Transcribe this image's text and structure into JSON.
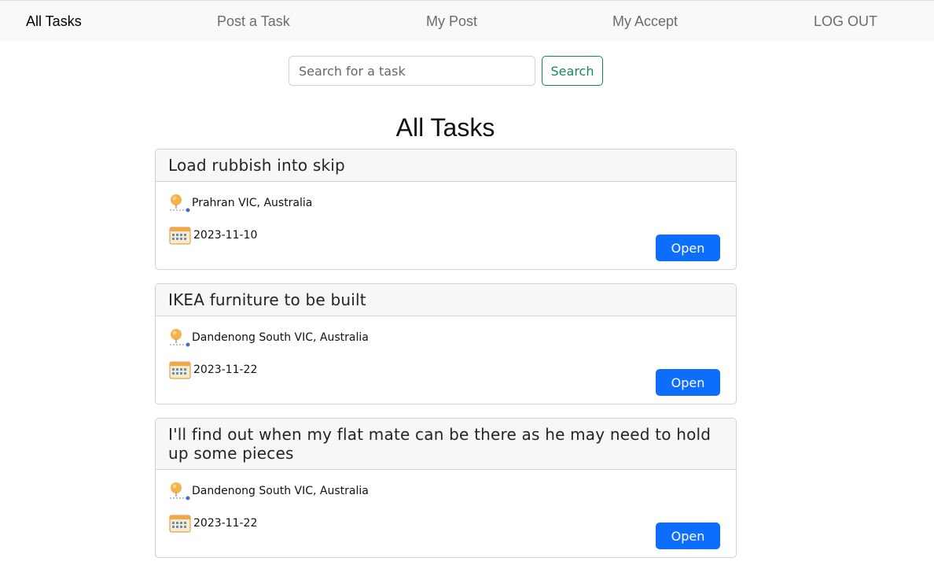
{
  "nav": {
    "items": [
      {
        "label": "All Tasks"
      },
      {
        "label": "Post a Task"
      },
      {
        "label": "My Post"
      },
      {
        "label": "My Accept"
      },
      {
        "label": "LOG OUT"
      }
    ]
  },
  "search": {
    "placeholder": "Search for a task",
    "value": "",
    "button_label": "Search"
  },
  "page": {
    "title": "All Tasks"
  },
  "tasks": [
    {
      "title": "Load rubbish into skip",
      "location": "Prahran VIC, Australia",
      "date": "2023-11-10",
      "button_label": "Open"
    },
    {
      "title": "IKEA furniture to be built",
      "location": "Dandenong South VIC, Australia",
      "date": "2023-11-22",
      "button_label": "Open"
    },
    {
      "title": "I'll find out when my flat mate can be there as he may need to hold up some pieces",
      "location": "Dandenong South VIC, Australia",
      "date": "2023-11-22",
      "button_label": "Open"
    }
  ],
  "colors": {
    "primary": "#0d6efd",
    "success": "#198754",
    "navbar_bg": "#f8f9fa",
    "card_header_bg": "#f7f7f7"
  },
  "icons": {
    "location": "map-pin-icon",
    "date": "calendar-icon"
  }
}
